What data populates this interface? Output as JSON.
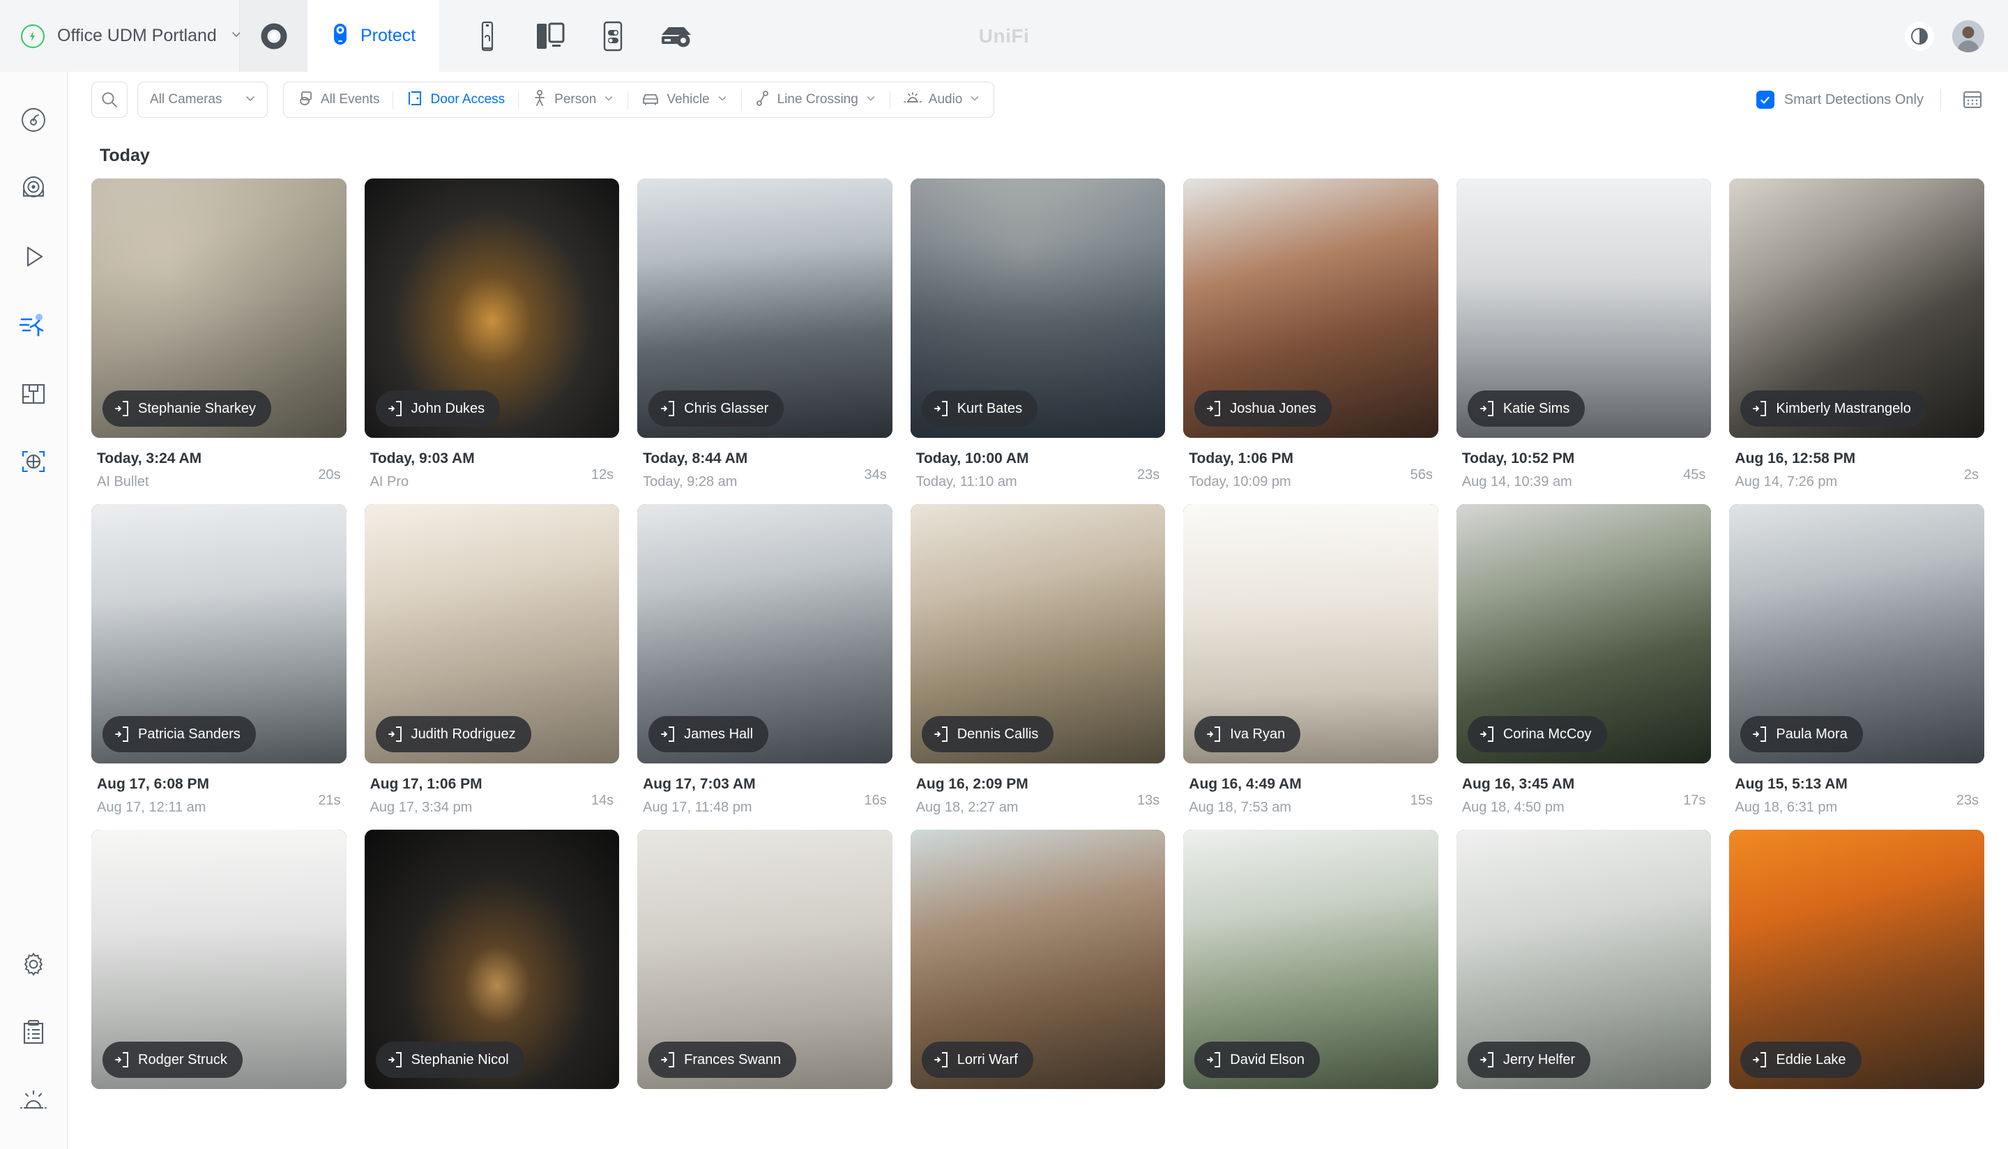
{
  "topbar": {
    "site_name": "Office UDM Portland",
    "bolt_icon": "bolt-icon",
    "chevron_icon": "chevron-down-icon",
    "app_switch_icon": "app-switcher-icon",
    "active_app": "Protect",
    "device_buttons": [
      {
        "icon": "camera-device-icon",
        "name": "cameras"
      },
      {
        "icon": "door-hub-device-icon",
        "name": "doors"
      },
      {
        "icon": "access-reader-device-icon",
        "name": "readers"
      },
      {
        "icon": "gateway-settings-device-icon",
        "name": "gateway"
      }
    ],
    "brand": "UniFi",
    "theme_toggle_icon": "contrast-icon",
    "avatar_icon": "avatar"
  },
  "rail": {
    "top_items": [
      {
        "name": "dashboard",
        "icon": "gauge-icon",
        "active": false
      },
      {
        "name": "cameras",
        "icon": "camera-lens-icon",
        "active": false
      },
      {
        "name": "playback",
        "icon": "play-icon",
        "active": false
      },
      {
        "name": "detections",
        "icon": "person-running-icon",
        "active": true
      },
      {
        "name": "floorplans",
        "icon": "floorplan-icon",
        "active": false
      },
      {
        "name": "ai-search",
        "icon": "target-crosshair-icon",
        "active": false
      }
    ],
    "bottom_items": [
      {
        "name": "settings",
        "icon": "gear-icon",
        "active": false
      },
      {
        "name": "logs",
        "icon": "clipboard-list-icon",
        "active": false
      },
      {
        "name": "alarms",
        "icon": "alarm-light-icon",
        "active": false
      }
    ]
  },
  "filterbar": {
    "search_icon": "search-icon",
    "camera_select": {
      "value": "All Cameras",
      "chevron": "chevron-down-icon"
    },
    "chips": [
      {
        "label": "All Events",
        "icon": "stacked-events-icon",
        "active": false,
        "has_chevron": false
      },
      {
        "label": "Door Access",
        "icon": "door-icon",
        "active": true,
        "has_chevron": false
      },
      {
        "label": "Person",
        "icon": "person-icon",
        "active": false,
        "has_chevron": true
      },
      {
        "label": "Vehicle",
        "icon": "vehicle-icon",
        "active": false,
        "has_chevron": true
      },
      {
        "label": "Line Crossing",
        "icon": "line-crossing-icon",
        "active": false,
        "has_chevron": true
      },
      {
        "label": "Audio",
        "icon": "audio-alarm-icon",
        "active": false,
        "has_chevron": true
      }
    ],
    "smart_detections": {
      "label": "Smart Detections Only",
      "checked": true,
      "check_icon": "checkmark-icon"
    },
    "calendar_icon": "calendar-icon",
    "accent_color": "#006fff"
  },
  "main": {
    "day_label": "Today",
    "events": [
      {
        "person": "Stephanie Sharkey",
        "time": "Today, 3:24 AM",
        "sub": "AI Bullet",
        "duration": "20s",
        "scene": "atrium",
        "badge_icon": "door-access-icon"
      },
      {
        "person": "John Dukes",
        "time": "Today, 9:03 AM",
        "sub": "AI Pro",
        "duration": "12s",
        "scene": "corridor",
        "badge_icon": "door-access-icon"
      },
      {
        "person": "Chris Glasser",
        "time": "Today, 8:44 AM",
        "sub": "Today, 9:28 am",
        "duration": "34s",
        "scene": "openoffice",
        "badge_icon": "door-access-icon"
      },
      {
        "person": "Kurt Bates",
        "time": "Today, 10:00 AM",
        "sub": "Today, 11:10 am",
        "duration": "23s",
        "scene": "manwave",
        "badge_icon": "door-access-icon"
      },
      {
        "person": "Joshua Jones",
        "time": "Today, 1:06 PM",
        "sub": "Today, 10:09 pm",
        "duration": "56s",
        "scene": "brickhall",
        "badge_icon": "door-access-icon"
      },
      {
        "person": "Katie Sims",
        "time": "Today, 10:52 PM",
        "sub": "Aug 14, 10:39 am",
        "duration": "45s",
        "scene": "deskbw",
        "badge_icon": "door-access-icon"
      },
      {
        "person": "Kimberly Mastrangelo",
        "time": "Aug 16, 12:58 PM",
        "sub": "Aug 14, 7:26 pm",
        "duration": "2s",
        "scene": "wallboard",
        "badge_icon": "door-access-icon"
      },
      {
        "person": "Patricia Sanders",
        "time": "Aug 17, 6:08 PM",
        "sub": "Aug 17, 12:11 am",
        "duration": "21s",
        "scene": "meetingrm",
        "badge_icon": "door-access-icon"
      },
      {
        "person": "Judith Rodriguez",
        "time": "Aug 17, 1:06 PM",
        "sub": "Aug 17, 3:34 pm",
        "duration": "14s",
        "scene": "lobbylight",
        "badge_icon": "door-access-icon"
      },
      {
        "person": "James Hall",
        "time": "Aug 17, 7:03 AM",
        "sub": "Aug 17, 11:48 pm",
        "duration": "16s",
        "scene": "deskpair",
        "badge_icon": "door-access-icon"
      },
      {
        "person": "Dennis Callis",
        "time": "Aug 16, 2:09 PM",
        "sub": "Aug 18, 2:27 am",
        "duration": "13s",
        "scene": "womanhall",
        "badge_icon": "door-access-icon"
      },
      {
        "person": "Iva Ryan",
        "time": "Aug 16, 4:49 AM",
        "sub": "Aug 18, 7:53 am",
        "duration": "15s",
        "scene": "whiteboard",
        "badge_icon": "door-access-icon"
      },
      {
        "person": "Corina McCoy",
        "time": "Aug 16, 3:45 AM",
        "sub": "Aug 18, 4:50 pm",
        "duration": "17s",
        "scene": "delivery",
        "badge_icon": "door-access-icon"
      },
      {
        "person": "Paula Mora",
        "time": "Aug 15, 5:13 AM",
        "sub": "Aug 18, 6:31 pm",
        "duration": "23s",
        "scene": "storefront",
        "badge_icon": "door-access-icon"
      },
      {
        "person": "Rodger Struck",
        "time": "",
        "sub": "",
        "duration": "",
        "scene": "whitetable",
        "badge_icon": "door-access-icon"
      },
      {
        "person": "Stephanie Nicol",
        "time": "",
        "sub": "",
        "duration": "",
        "scene": "darkhall",
        "badge_icon": "door-access-icon"
      },
      {
        "person": "Frances Swann",
        "time": "",
        "sub": "",
        "duration": "",
        "scene": "concrete",
        "badge_icon": "door-access-icon"
      },
      {
        "person": "Lorri Warf",
        "time": "",
        "sub": "",
        "duration": "",
        "scene": "loungewood",
        "badge_icon": "door-access-icon"
      },
      {
        "person": "David Elson",
        "time": "",
        "sub": "",
        "duration": "",
        "scene": "plantroom",
        "badge_icon": "door-access-icon"
      },
      {
        "person": "Jerry Helfer",
        "time": "",
        "sub": "",
        "duration": "",
        "scene": "glasswall",
        "badge_icon": "door-access-icon"
      },
      {
        "person": "Eddie Lake",
        "time": "",
        "sub": "",
        "duration": "",
        "scene": "orangeroom",
        "badge_icon": "door-access-icon"
      }
    ]
  }
}
